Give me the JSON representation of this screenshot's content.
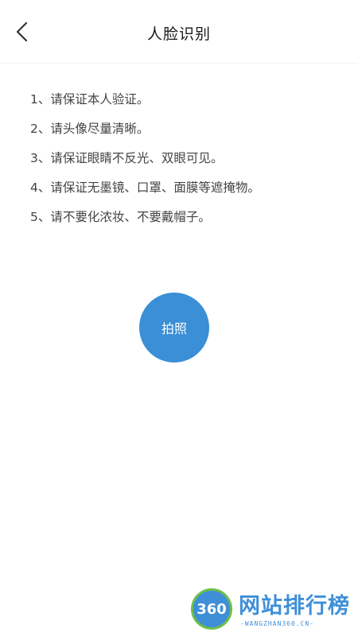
{
  "header": {
    "title": "人脸识别",
    "back_icon": "chevron-left-icon"
  },
  "instructions": [
    "1、请保证本人验证。",
    "2、请头像尽量清晰。",
    "3、请保证眼睛不反光、双眼可见。",
    "4、请保证无墨镜、口罩、面膜等遮掩物。",
    "5、请不要化浓妆、不要戴帽子。"
  ],
  "capture_button": {
    "label": "拍照",
    "color": "#3a8fd6"
  },
  "watermark": {
    "badge": "360",
    "text": "网站排行榜",
    "subtext": "-WANGZHAN360.CN-"
  }
}
